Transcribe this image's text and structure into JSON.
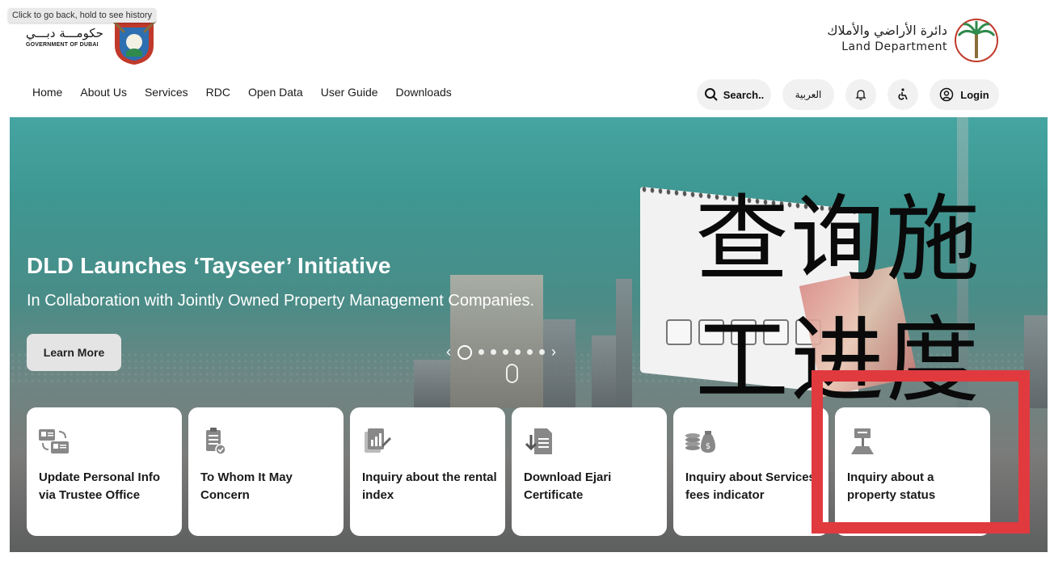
{
  "tooltip": "Click to go back, hold to see history",
  "gov_logo": {
    "arabic": "حكومـــة دبـــي",
    "english": "GOVERNMENT OF DUBAI"
  },
  "dld_logo": {
    "arabic": "دائرة الأراضي والأملاك",
    "english": "Land Department"
  },
  "nav": [
    {
      "label": "Home",
      "active": true
    },
    {
      "label": "About Us"
    },
    {
      "label": "Services"
    },
    {
      "label": "RDC"
    },
    {
      "label": "Open Data"
    },
    {
      "label": "User Guide"
    },
    {
      "label": "Downloads"
    }
  ],
  "actions": {
    "search": "Search..",
    "language": "العربية",
    "login": "Login"
  },
  "hero": {
    "title": "DLD Launches ‘Tayseer’ Initiative",
    "subtitle": "In Collaboration with Jointly Owned Property Management Companies.",
    "cta": "Learn More"
  },
  "overlay": {
    "line1": "查询施",
    "line2": "工进度",
    "color": "#0a0a0a"
  },
  "cards": [
    {
      "icon": "id-card-swap-icon",
      "label": "Update Personal Info via Trustee Office"
    },
    {
      "icon": "clipboard-check-icon",
      "label": "To Whom It May Concern"
    },
    {
      "icon": "document-chart-icon",
      "label": "Inquiry about the rental index"
    },
    {
      "icon": "download-document-icon",
      "label": "Download Ejari Certificate"
    },
    {
      "icon": "coins-money-bag-icon",
      "label": "Inquiry about Services fees indicator"
    },
    {
      "icon": "property-sign-icon",
      "label": "Inquiry about a property status"
    }
  ],
  "colors": {
    "accent": "#2f8a4c",
    "highlight": "#e03a3f",
    "hero_teal": "#45a5a1"
  }
}
